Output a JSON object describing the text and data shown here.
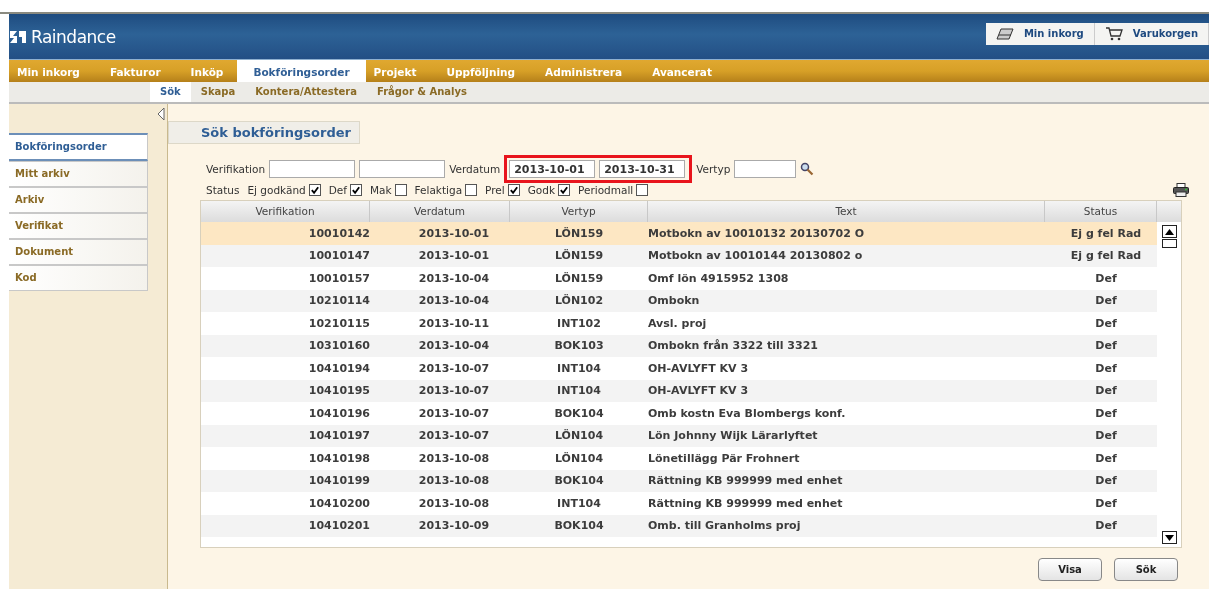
{
  "header": {
    "logo": "Raindance",
    "links": [
      {
        "label": "Min inkorg",
        "kind": "inbox"
      },
      {
        "label": "Varukorgen",
        "kind": "cart"
      }
    ]
  },
  "menu": [
    {
      "label": "Min inkorg",
      "selected": false
    },
    {
      "label": "Fakturor",
      "selected": false
    },
    {
      "label": "Inköp",
      "selected": false
    },
    {
      "label": "Bokföringsorder",
      "selected": true
    },
    {
      "label": "Projekt",
      "selected": false
    },
    {
      "label": "Uppföljning",
      "selected": false
    },
    {
      "label": "Administrera",
      "selected": false
    },
    {
      "label": "Avancerat",
      "selected": false
    }
  ],
  "submenu": [
    {
      "label": "Sök",
      "selected": true
    },
    {
      "label": "Skapa",
      "selected": false
    },
    {
      "label": "Kontera/Attestera",
      "selected": false
    },
    {
      "label": "Frågor & Analys",
      "selected": false
    }
  ],
  "sidebar": {
    "items": [
      {
        "label": "Bokföringsorder",
        "selected": true
      },
      {
        "label": "Mitt arkiv",
        "selected": false
      },
      {
        "label": "Arkiv",
        "selected": false
      },
      {
        "label": "Verifikat",
        "selected": false
      },
      {
        "label": "Dokument",
        "selected": false
      },
      {
        "label": "Kod",
        "selected": false
      }
    ]
  },
  "page_title": "Sök bokföringsorder",
  "search": {
    "verifikation_label": "Verifikation",
    "verdatum_label": "Verdatum",
    "verdatum_from": "2013-10-01",
    "verdatum_to": "2013-10-31",
    "vertyp_label": "Vertyp"
  },
  "status_filter": {
    "label": "Status",
    "options": [
      {
        "label": "Ej godkänd",
        "checked": true
      },
      {
        "label": "Def",
        "checked": true
      },
      {
        "label": "Mak",
        "checked": false
      },
      {
        "label": "Felaktiga",
        "checked": false
      },
      {
        "label": "Prel",
        "checked": true
      },
      {
        "label": "Godk",
        "checked": true
      },
      {
        "label": "Periodmall",
        "checked": false
      }
    ]
  },
  "table": {
    "columns": [
      "Verifikation",
      "Verdatum",
      "Vertyp",
      "Text",
      "Status"
    ],
    "rows": [
      {
        "cells": [
          "10010142",
          "2013-10-01",
          "LÖN159",
          "Motbokn av 10010132 20130702 O",
          "Ej g fel Rad"
        ],
        "selected": true
      },
      {
        "cells": [
          "10010147",
          "2013-10-01",
          "LÖN159",
          "Motbokn av 10010144 20130802 o",
          "Ej g fel Rad"
        ],
        "selected": false
      },
      {
        "cells": [
          "10010157",
          "2013-10-04",
          "LÖN159",
          "Omf lön 4915952 1308",
          "Def"
        ],
        "selected": false
      },
      {
        "cells": [
          "10210114",
          "2013-10-04",
          "LÖN102",
          "Ombokn",
          "Def"
        ],
        "selected": false
      },
      {
        "cells": [
          "10210115",
          "2013-10-11",
          "INT102",
          "Avsl. proj",
          "Def"
        ],
        "selected": false
      },
      {
        "cells": [
          "10310160",
          "2013-10-04",
          "BOK103",
          "Ombokn från 3322 till 3321",
          "Def"
        ],
        "selected": false
      },
      {
        "cells": [
          "10410194",
          "2013-10-07",
          "INT104",
          "OH-AVLYFT KV 3",
          "Def"
        ],
        "selected": false
      },
      {
        "cells": [
          "10410195",
          "2013-10-07",
          "INT104",
          "OH-AVLYFT KV 3",
          "Def"
        ],
        "selected": false
      },
      {
        "cells": [
          "10410196",
          "2013-10-07",
          "BOK104",
          "Omb kostn Eva Blombergs konf.",
          "Def"
        ],
        "selected": false
      },
      {
        "cells": [
          "10410197",
          "2013-10-07",
          "LÖN104",
          "Lön Johnny Wijk Lärarlyftet",
          "Def"
        ],
        "selected": false
      },
      {
        "cells": [
          "10410198",
          "2013-10-08",
          "LÖN104",
          "Lönetillägg Pär Frohnert",
          "Def"
        ],
        "selected": false
      },
      {
        "cells": [
          "10410199",
          "2013-10-08",
          "BOK104",
          "Rättning KB 999999 med enhet",
          "Def"
        ],
        "selected": false
      },
      {
        "cells": [
          "10410200",
          "2013-10-08",
          "INT104",
          "Rättning KB 999999 med enhet",
          "Def"
        ],
        "selected": false
      },
      {
        "cells": [
          "10410201",
          "2013-10-09",
          "BOK104",
          "Omb. till Granholms proj",
          "Def"
        ],
        "selected": false
      }
    ]
  },
  "buttons": [
    "Visa",
    "Sök"
  ]
}
